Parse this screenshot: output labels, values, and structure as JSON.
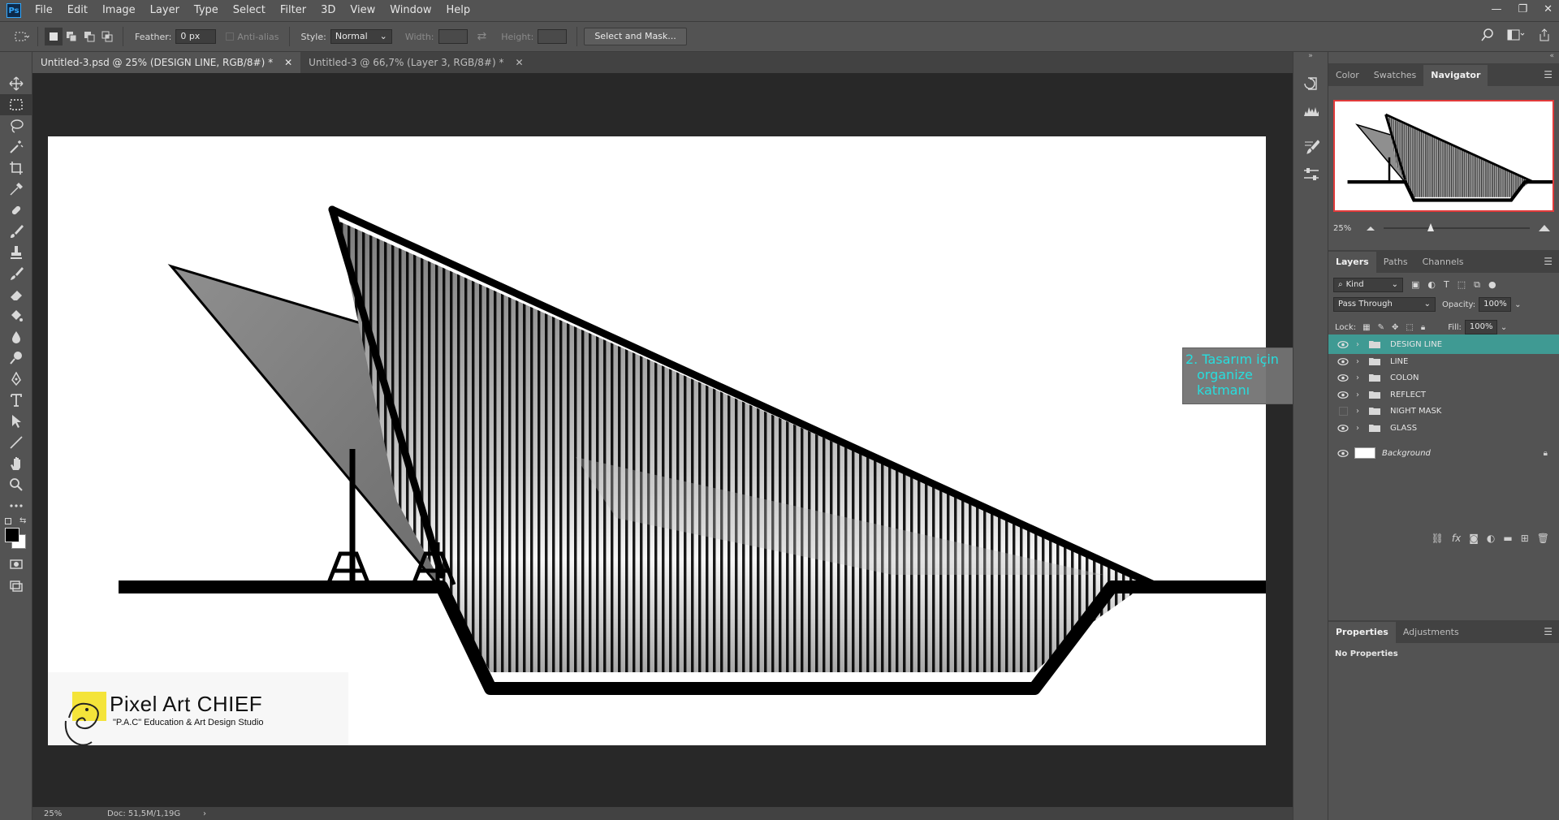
{
  "app": {
    "logo": "Ps",
    "window_controls": [
      "—",
      "❐",
      "✕"
    ]
  },
  "menu": [
    "File",
    "Edit",
    "Image",
    "Layer",
    "Type",
    "Select",
    "Filter",
    "3D",
    "View",
    "Window",
    "Help"
  ],
  "options": {
    "feather_label": "Feather:",
    "feather_value": "0 px",
    "antialias_label": "Anti-alias",
    "style_label": "Style:",
    "style_value": "Normal",
    "width_label": "Width:",
    "height_label": "Height:",
    "select_mask_button": "Select and Mask..."
  },
  "tabs": [
    {
      "label": "Untitled-3.psd @ 25% (DESIGN LINE, RGB/8#) *",
      "close": "✕"
    },
    {
      "label": "Untitled-3 @ 66,7% (Layer 3, RGB/8#) *",
      "close": "✕"
    }
  ],
  "status": {
    "zoom": "25%",
    "doc": "Doc: 51,5M/1,19G",
    "arrow": "›"
  },
  "annotation": {
    "line1": "2. Tasarım için",
    "line2": "organize katmanı"
  },
  "watermark": {
    "title": "Pixel Art CHIEF",
    "subtitle": "\"P.A.C\" Education & Art Design Studio"
  },
  "navigator": {
    "tabs": [
      "Color",
      "Swatches",
      "Navigator"
    ],
    "zoom": "25%",
    "slider_position": 0.3
  },
  "layers": {
    "tabs": [
      "Layers",
      "Paths",
      "Channels"
    ],
    "kind_label": "Kind",
    "blend_mode": "Pass Through",
    "opacity_label": "Opacity:",
    "opacity_value": "100%",
    "lock_label": "Lock:",
    "fill_label": "Fill:",
    "fill_value": "100%",
    "items": [
      {
        "name": "DESIGN LINE",
        "visible": true,
        "selected": true
      },
      {
        "name": "LINE",
        "visible": true
      },
      {
        "name": "COLON",
        "visible": true
      },
      {
        "name": "REFLECT",
        "visible": true
      },
      {
        "name": "NIGHT MASK",
        "visible": false
      },
      {
        "name": "GLASS",
        "visible": true
      }
    ],
    "background_name": "Background",
    "footer_icons": [
      "link-icon",
      "fx-icon",
      "mask-icon",
      "adjustment-icon",
      "folder-icon",
      "new-layer-icon",
      "trash-icon"
    ]
  },
  "properties": {
    "tabs": [
      "Properties",
      "Adjustments"
    ],
    "empty_text": "No Properties"
  },
  "colors": {
    "accent": "#31a8ff",
    "selected_layer": "#3f9a93",
    "annotation_text": "#27dede"
  }
}
